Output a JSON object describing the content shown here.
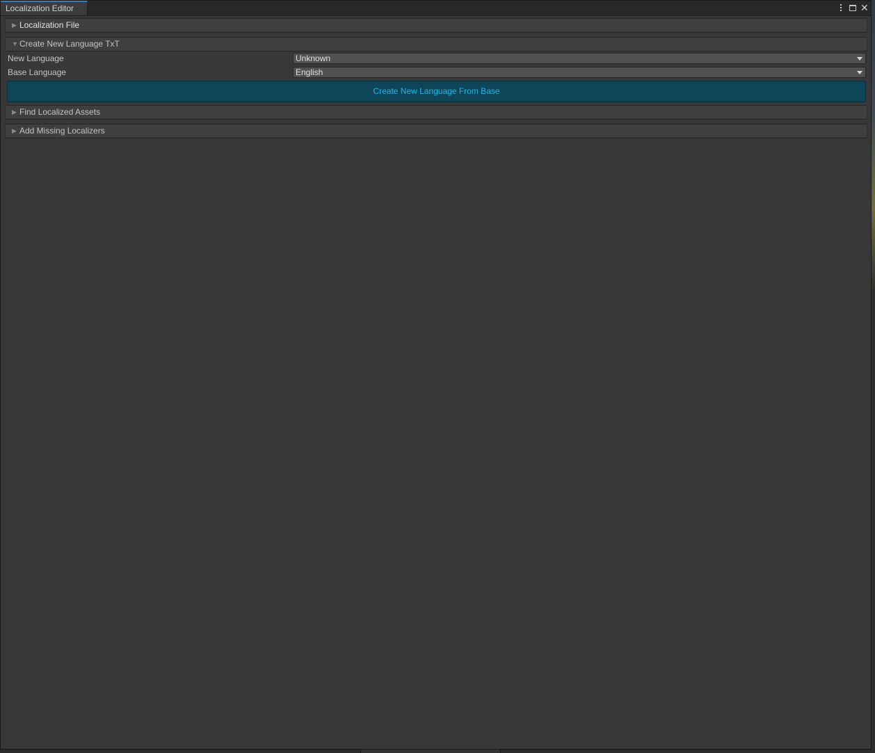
{
  "window": {
    "tab_title": "Localization Editor",
    "menu_icon": "kebab-menu-icon",
    "maximize_icon": "maximize-icon",
    "close_icon": "close-icon"
  },
  "sections": {
    "localization_file": {
      "label": "Localization File",
      "expanded": false
    },
    "create_new_language": {
      "label": "Create New Language TxT",
      "expanded": true,
      "fields": {
        "new_language": {
          "label": "New Language",
          "value": "Unknown"
        },
        "base_language": {
          "label": "Base Language",
          "value": "English"
        }
      },
      "button_label": "Create New Language From Base"
    },
    "find_localized_assets": {
      "label": "Find Localized Assets",
      "expanded": false
    },
    "add_missing_localizers": {
      "label": "Add Missing Localizers",
      "expanded": false
    }
  },
  "colors": {
    "panel_bg": "#383838",
    "accent_tab": "#3a79bb",
    "button_bg": "#0e4559",
    "button_text": "#1fb6e8"
  }
}
